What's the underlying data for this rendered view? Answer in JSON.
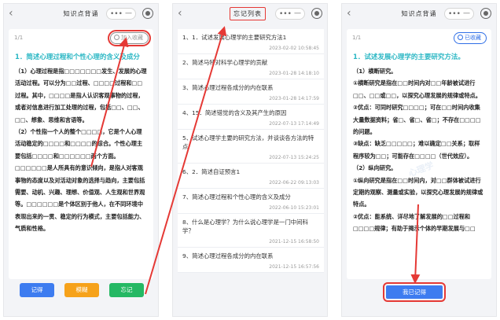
{
  "phone1": {
    "title": "知识点背诵",
    "back_icon": "‹",
    "capsule_dots": "•••",
    "capsule_line": "—",
    "page_no": "1/1",
    "collect_label": "加入收藏",
    "question_title": "1．简述心理过程和个性心理的含义及成分",
    "body": [
      "（1）心理过程是指□□□□□□□发生、发展的心理活动过程。可以分为□□过程、□□□□过程和□□过程。其中，□□□□是指人认识客观事物的过程，或者对信息进行加工处理的过程，包括□□、□□、□□、想象、思维和言语等。",
      "（2）个性指一个人的整个□□□□，它是个人心理活动稳定的□□□□和□□□□的综合。个性心理主要包括□□□□和□□□□□□两个方面。□□□□□□是人所具有的意识倾向，是指人对客观事物的态度以及对活动对象的选择与趋向，主要包括需要、动机、兴趣、理想、价值观、人生观和世界观等。□□□□□□是个体区别于他人，在不同环境中表现出来的一贯、稳定的行为模式，主要包括能力、气质和性格。"
    ],
    "buttons": {
      "remember": "记得",
      "vague": "模糊",
      "forget": "忘记"
    }
  },
  "phone2": {
    "title": "忘记列表",
    "back_icon": "‹",
    "capsule_dots": "•••",
    "capsule_line": "—",
    "items": [
      {
        "text": "1、1．试述发展心理学的主要研究方法1",
        "date": "2023-02-02 10:58:45"
      },
      {
        "text": "2、简述马特对科学心理学的贡献",
        "date": "2023-01-28 14:18:10"
      },
      {
        "text": "3、简述心理过程各成分的内在联系",
        "date": "2023-01-28 14:17:59"
      },
      {
        "text": "4、15．简述错觉的含义及其产生的原因",
        "date": "2022-07-13 17:14:49"
      },
      {
        "text": "5、试述心理学主要的研究方法，并谈谈各方法的特点",
        "date": "2022-07-13 15:24:25"
      },
      {
        "text": "6、2．简述自证预言1",
        "date": "2022-06-22 09:13:03"
      },
      {
        "text": "7、简述心理过程和个性心理的含义及成分",
        "date": "2022-06-10 15:23:01"
      },
      {
        "text": "8、什么是心理学？为什么说心理学是一门中间科学？",
        "date": "2021-12-15 16:58:50"
      },
      {
        "text": "9、简述心理过程各成分的内在联系",
        "date": "2021-12-15 16:57:56"
      }
    ]
  },
  "phone3": {
    "title": "知识点背诵",
    "back_icon": "‹",
    "capsule_dots": "•••",
    "capsule_line": "—",
    "page_no": "1/1",
    "collect_label": "已收藏",
    "question_title": "1．试述发展心理学的主要研究方法。",
    "body": [
      "（1）横断研究。",
      "①横断研究是指在□□时间内对□□年龄被试进行□□、□□或□□，以探究心理发展的规律或特点。",
      "②优点：可同时研究□□□□；可在□□时间内收集大量数据资料；省□、省□、省□；不存在□□□□的问题。",
      "③缺点：缺乏□□□□□；难以确定□□关系；取样程序较为□□；可能存在□□□□（世代效应）。",
      "（2）纵向研究。",
      "①纵向研究是指在□□时间内，对□□群体被试进行定期的观察、测量或实验，以探究心理发展的规律或特点。",
      "②优点：能系统、详尽地了解发展的□□过程和□□□□规律；有助于揭示个体的早期发展与□□"
    ],
    "done_button": "我已记得",
    "watermark": "心理学"
  },
  "colors": {
    "accent": "#2bb7c4",
    "annotation": "#e53935",
    "primary": "#3d7cf0"
  }
}
